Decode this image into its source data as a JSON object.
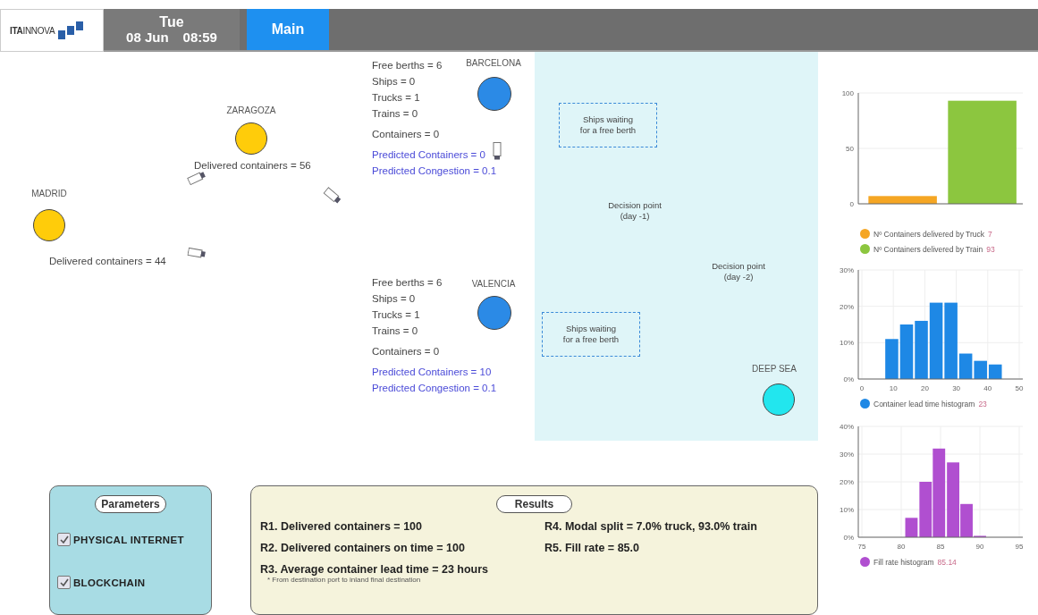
{
  "header": {
    "logo": "**ITA**INNOVA",
    "day": "Tue",
    "date": "08 Jun",
    "time": "08:59",
    "tabs": [
      {
        "label": "Main",
        "selected": true
      }
    ]
  },
  "map": {
    "cities": [
      {
        "name": "ZARAGOZA",
        "delivered": "Delivered containers = 56"
      },
      {
        "name": "MADRID",
        "delivered": "Delivered containers = 44"
      }
    ],
    "ports": [
      {
        "name": "BARCELONA",
        "stats": [
          "Free berths = 6",
          "Ships = 0",
          "Trucks = 1",
          "Trains = 0"
        ],
        "containers": "Containers = 0",
        "predicted": [
          "Predicted Containers = 0",
          "Predicted Congestion = 0.1"
        ]
      },
      {
        "name": "VALENCIA",
        "stats": [
          "Free berths = 6",
          "Ships = 0",
          "Trucks = 1",
          "Trains = 0"
        ],
        "containers": "Containers = 0",
        "predicted": [
          "Predicted Containers = 10",
          "Predicted Congestion = 0.1"
        ]
      }
    ],
    "waiting_areas": [
      {
        "lines": [
          "Ships waiting",
          "for a free berth"
        ]
      },
      {
        "lines": [
          "Ships waiting",
          "for a free berth"
        ]
      }
    ],
    "decision_points": [
      {
        "lines": [
          "Decision point",
          "(day -1)"
        ]
      },
      {
        "lines": [
          "Decision point",
          "(day -2)"
        ]
      }
    ],
    "deep_sea": {
      "name": "DEEP SEA"
    }
  },
  "parameters": {
    "title": "Parameters",
    "options": [
      {
        "label": "PHYSICAL INTERNET",
        "checked": true
      },
      {
        "label": "BLOCKCHAIN",
        "checked": true
      }
    ]
  },
  "results": {
    "title": "Results",
    "left": [
      "R1. Delivered containers = 100",
      "R2. Delivered containers on time = 100",
      "R3. Average container lead time = 23 hours"
    ],
    "footnote": "* From destination port to inland final destination",
    "right": [
      "R4. Modal split = 7.0% truck, 93.0% train",
      "R5. Fill rate = 85.0"
    ]
  },
  "charts": [
    {
      "legend_values": [
        "7",
        "93"
      ],
      "chart_data": {
        "type": "bar",
        "grid": true,
        "ylim": [
          0,
          100
        ],
        "yticks": [
          0,
          50,
          100
        ],
        "series": [
          {
            "name": "Nº Containers delivered by Truck",
            "color": "#f5a623",
            "values": [
              7,
              null
            ]
          },
          {
            "name": "Nº Containers delivered by Train",
            "color": "#8cc63f",
            "values": [
              null,
              93
            ]
          }
        ]
      }
    },
    {
      "legend_values": [
        "23"
      ],
      "chart_data": {
        "type": "bar",
        "grid": true,
        "x": [
          9.5,
          14.2,
          18.9,
          23.6,
          28.3,
          33,
          37.7,
          42.4
        ],
        "xlim": [
          0,
          50
        ],
        "ylim": [
          0,
          30
        ],
        "xticks": [
          0,
          10,
          20,
          30,
          40,
          50
        ],
        "yticks": [
          {
            "value": 0,
            "label": "0%"
          },
          {
            "value": 10,
            "label": "10%"
          },
          {
            "value": 20,
            "label": "20%"
          },
          {
            "value": 30,
            "label": "30%"
          }
        ],
        "series": [
          {
            "name": "Container lead time histogram",
            "color": "#1e88e5",
            "values": [
              11,
              15,
              16,
              21,
              21,
              7,
              5,
              4
            ]
          }
        ]
      }
    },
    {
      "legend_values": [
        "85.14"
      ],
      "chart_data": {
        "type": "bar",
        "grid": true,
        "x": [
          81.3,
          83.1,
          84.8,
          86.6,
          88.3,
          90
        ],
        "xlim": [
          75,
          95
        ],
        "ylim": [
          0,
          40
        ],
        "xticks": [
          75,
          80,
          85,
          90,
          95
        ],
        "yticks": [
          {
            "value": 0,
            "label": "0%"
          },
          {
            "value": 10,
            "label": "10%"
          },
          {
            "value": 20,
            "label": "20%"
          },
          {
            "value": 30,
            "label": "30%"
          },
          {
            "value": 40,
            "label": "40%"
          }
        ],
        "series": [
          {
            "name": "Fill rate histogram",
            "color": "#b04fd0",
            "values": [
              7,
              20,
              32,
              27,
              12,
              0.5
            ]
          }
        ]
      }
    }
  ]
}
